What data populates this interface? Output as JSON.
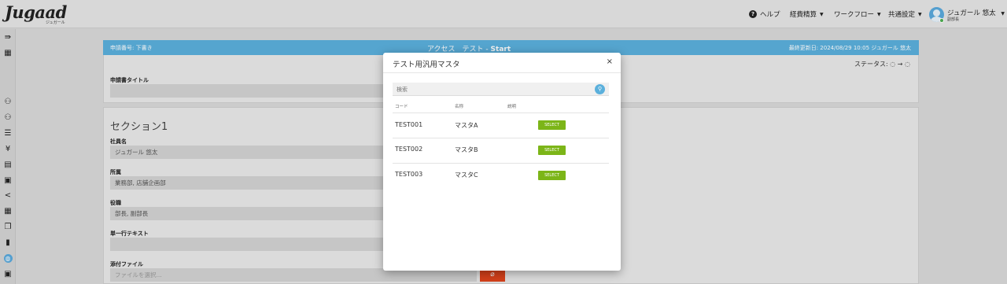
{
  "header": {
    "logo_text": "Jugaad",
    "logo_subtext": "ジュガール",
    "help_label": "ヘルプ",
    "nav": [
      {
        "label": "経費精算"
      },
      {
        "label": "ワークフロー"
      },
      {
        "label": "共通設定"
      }
    ],
    "user": {
      "name": "ジュガール 悠太",
      "role": "副部長"
    }
  },
  "sidebar": {
    "icons": [
      "expand-icon",
      "building-icon",
      "users-icon",
      "users-alt-icon",
      "list-icon",
      "yen-icon",
      "document-icon",
      "receipt-icon",
      "share-icon",
      "grid-icon",
      "copy-icon",
      "file-icon",
      "globe-icon",
      "logout-icon"
    ]
  },
  "form": {
    "application_number": "申請番号: 下書き",
    "title_prefix": "アクセス　テスト - ",
    "title_bold": "Start",
    "last_updated": "最終更新日: 2024/08/29 10:05  ジュガール 悠太",
    "status_label": "ステータス: ◌ → ◌",
    "request_title_label": "申請書タイトル",
    "section_title": "セクション1",
    "fields": [
      {
        "label": "社員名",
        "value": "ジュガール 悠太"
      },
      {
        "label": "所属",
        "value": "業務部, 店舗企画部"
      },
      {
        "label": "役職",
        "value": "部長, 副部長"
      },
      {
        "label": "単一行テキスト",
        "value": ""
      },
      {
        "label": "添付ファイル",
        "value": "ファイルを選択..."
      }
    ]
  },
  "modal": {
    "title": "テスト用汎用マスタ",
    "close_label": "×",
    "search_placeholder": "検索",
    "columns": [
      "コード",
      "名称",
      "説明"
    ],
    "rows": [
      {
        "code": "TEST001",
        "name": "マスタA",
        "description": "",
        "action": "SELECT"
      },
      {
        "code": "TEST002",
        "name": "マスタB",
        "description": "",
        "action": "SELECT"
      },
      {
        "code": "TEST003",
        "name": "マスタC",
        "description": "",
        "action": "SELECT"
      }
    ]
  },
  "colors": {
    "accent": "#5bb0dc",
    "select_button": "#7cb518",
    "attach_button": "#e0441c"
  }
}
